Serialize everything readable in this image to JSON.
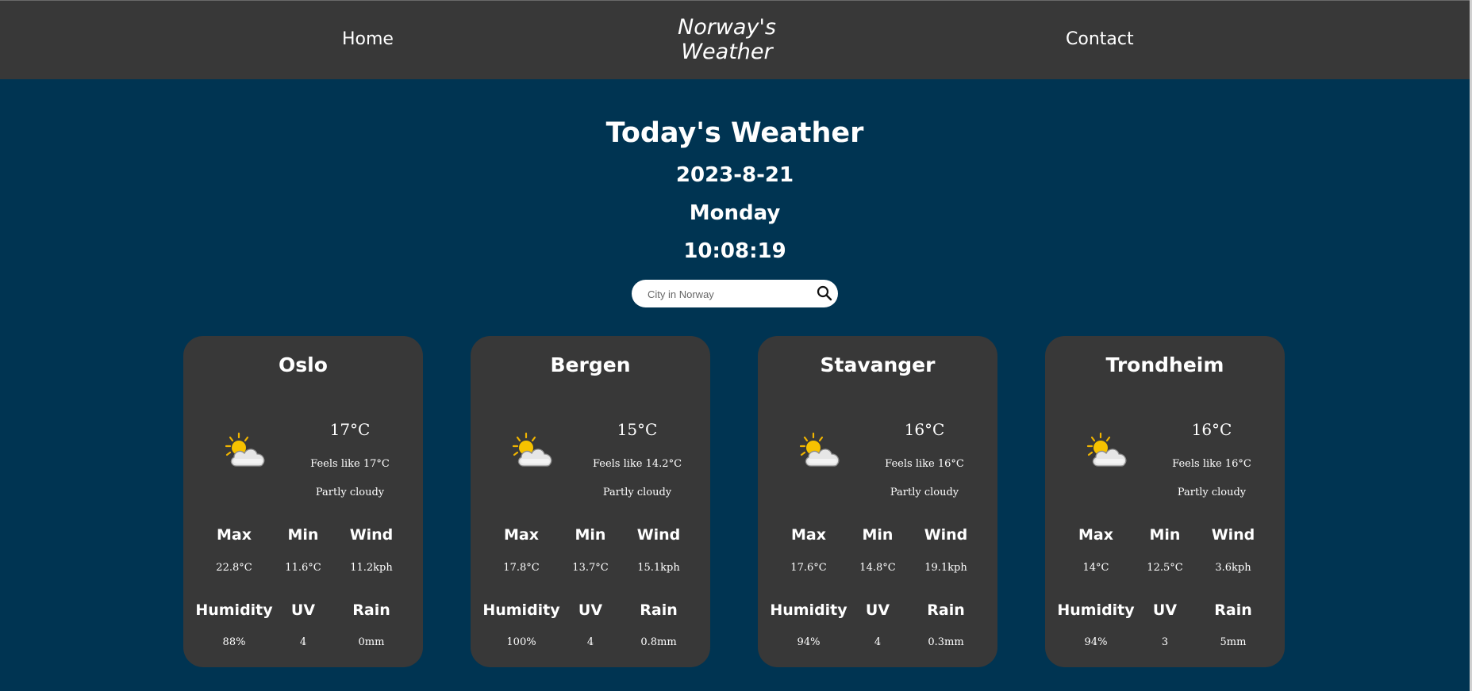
{
  "nav": {
    "home_label": "Home",
    "brand_line1": "Norway's",
    "brand_line2": "Weather",
    "contact_label": "Contact"
  },
  "header": {
    "title": "Today's Weather",
    "date": "2023-8-21",
    "day": "Monday",
    "time": "10:08:19"
  },
  "search": {
    "placeholder": "City in Norway",
    "value": ""
  },
  "colors": {
    "page_background": "#003452",
    "nav_background": "#383838",
    "card_background": "#383838",
    "text": "#ffffff"
  },
  "labels": {
    "max": "Max",
    "min": "Min",
    "wind": "Wind",
    "humidity": "Humidity",
    "uv": "UV",
    "rain": "Rain"
  },
  "cards": [
    {
      "city": "Oslo",
      "icon": "partly-cloudy-icon",
      "temp": "17°C",
      "feels_like": "Feels like 17°C",
      "condition": "Partly cloudy",
      "max": "22.8°C",
      "min": "11.6°C",
      "wind": "11.2kph",
      "humidity": "88%",
      "uv": "4",
      "rain": "0mm"
    },
    {
      "city": "Bergen",
      "icon": "partly-cloudy-icon",
      "temp": "15°C",
      "feels_like": "Feels like 14.2°C",
      "condition": "Partly cloudy",
      "max": "17.8°C",
      "min": "13.7°C",
      "wind": "15.1kph",
      "humidity": "100%",
      "uv": "4",
      "rain": "0.8mm"
    },
    {
      "city": "Stavanger",
      "icon": "partly-cloudy-icon",
      "temp": "16°C",
      "feels_like": "Feels like 16°C",
      "condition": "Partly cloudy",
      "max": "17.6°C",
      "min": "14.8°C",
      "wind": "19.1kph",
      "humidity": "94%",
      "uv": "4",
      "rain": "0.3mm"
    },
    {
      "city": "Trondheim",
      "icon": "partly-cloudy-icon",
      "temp": "16°C",
      "feels_like": "Feels like 16°C",
      "condition": "Partly cloudy",
      "max": "14°C",
      "min": "12.5°C",
      "wind": "3.6kph",
      "humidity": "94%",
      "uv": "3",
      "rain": "5mm"
    }
  ]
}
